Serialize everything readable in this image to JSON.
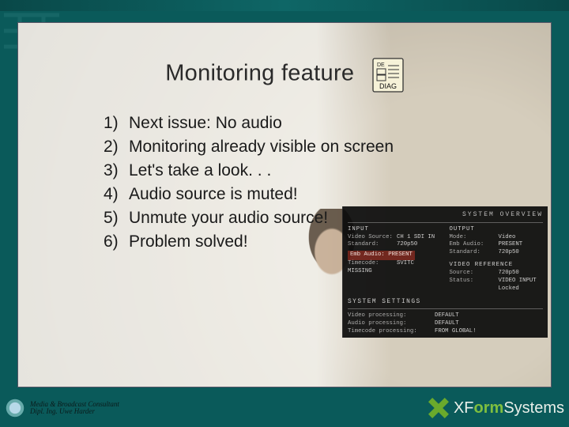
{
  "title": "Monitoring feature",
  "diag_label": "DIAG",
  "points": [
    "Next issue: No audio",
    "Monitoring already visible on screen",
    "Let's take a look. . .",
    "Audio source is muted!",
    "Unmute your audio source!",
    "Problem solved!"
  ],
  "overlay": {
    "heading": "SYSTEM OVERVIEW",
    "input_head": "INPUT",
    "output_head": "OUTPUT",
    "input": {
      "video_source_label": "Video Source:",
      "video_source_val": "CH 1 SDI IN",
      "standard_label": "Standard:",
      "standard_val": "720p50",
      "emb_audio_label": "Emb Audio:",
      "emb_audio_val": "PRESENT",
      "timecode_label": "Timecode:",
      "timecode_val": "SVITC MISSING"
    },
    "output": {
      "mode_label": "Mode:",
      "mode_val": "Video",
      "emb_audio_label": "Emb Audio:",
      "emb_audio_val": "PRESENT",
      "standard_label": "Standard:",
      "standard_val": "720p50"
    },
    "video_ref_head": "VIDEO REFERENCE",
    "video_ref": {
      "source_label": "Source:",
      "source_val": "720p50",
      "status_label": "Status:",
      "status_val": "VIDEO INPUT",
      "extra_label": "",
      "extra_val": "Locked"
    },
    "sys_head": "SYSTEM SETTINGS",
    "sys": {
      "vp_label": "Video processing:",
      "vp_val": "DEFAULT",
      "ap_label": "Audio processing:",
      "ap_val": "DEFAULT",
      "tp_label": "Timecode processing:",
      "tp_val": "FROM GLOBAL!"
    }
  },
  "footer": {
    "line1": "Media & Broadcast Consultant",
    "line2": "Dipl. Ing. Uwe Harder"
  },
  "brand": {
    "pre": "X",
    "mid": "F",
    "orm": "orm",
    "suffix": "Systems"
  }
}
